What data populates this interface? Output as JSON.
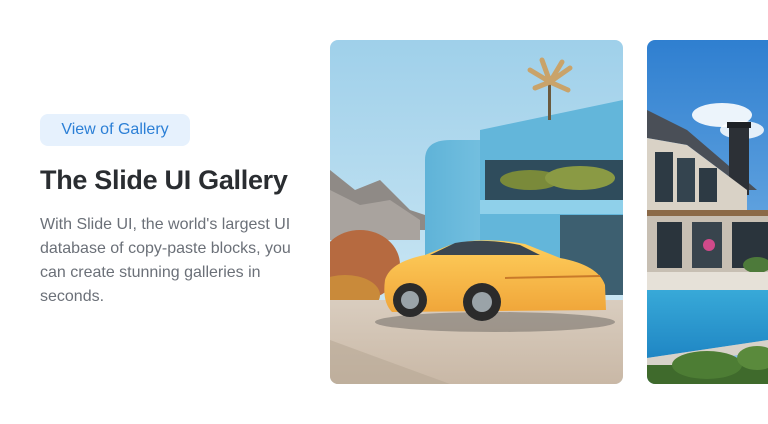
{
  "hero": {
    "badge_label": "View of Gallery",
    "title": "The Slide UI Gallery",
    "description": "With Slide UI, the world's largest UI database of copy-paste blocks, you can create stunning galleries in seconds."
  },
  "gallery": {
    "items": [
      {
        "subject": "yellow sports car in front of blue modern house"
      },
      {
        "subject": "modern villa with swimming pool"
      }
    ]
  },
  "colors": {
    "badge_bg": "#e6f1fd",
    "badge_text": "#2b7fd6",
    "title_text": "#2a2d31",
    "body_text": "#6b7078"
  }
}
